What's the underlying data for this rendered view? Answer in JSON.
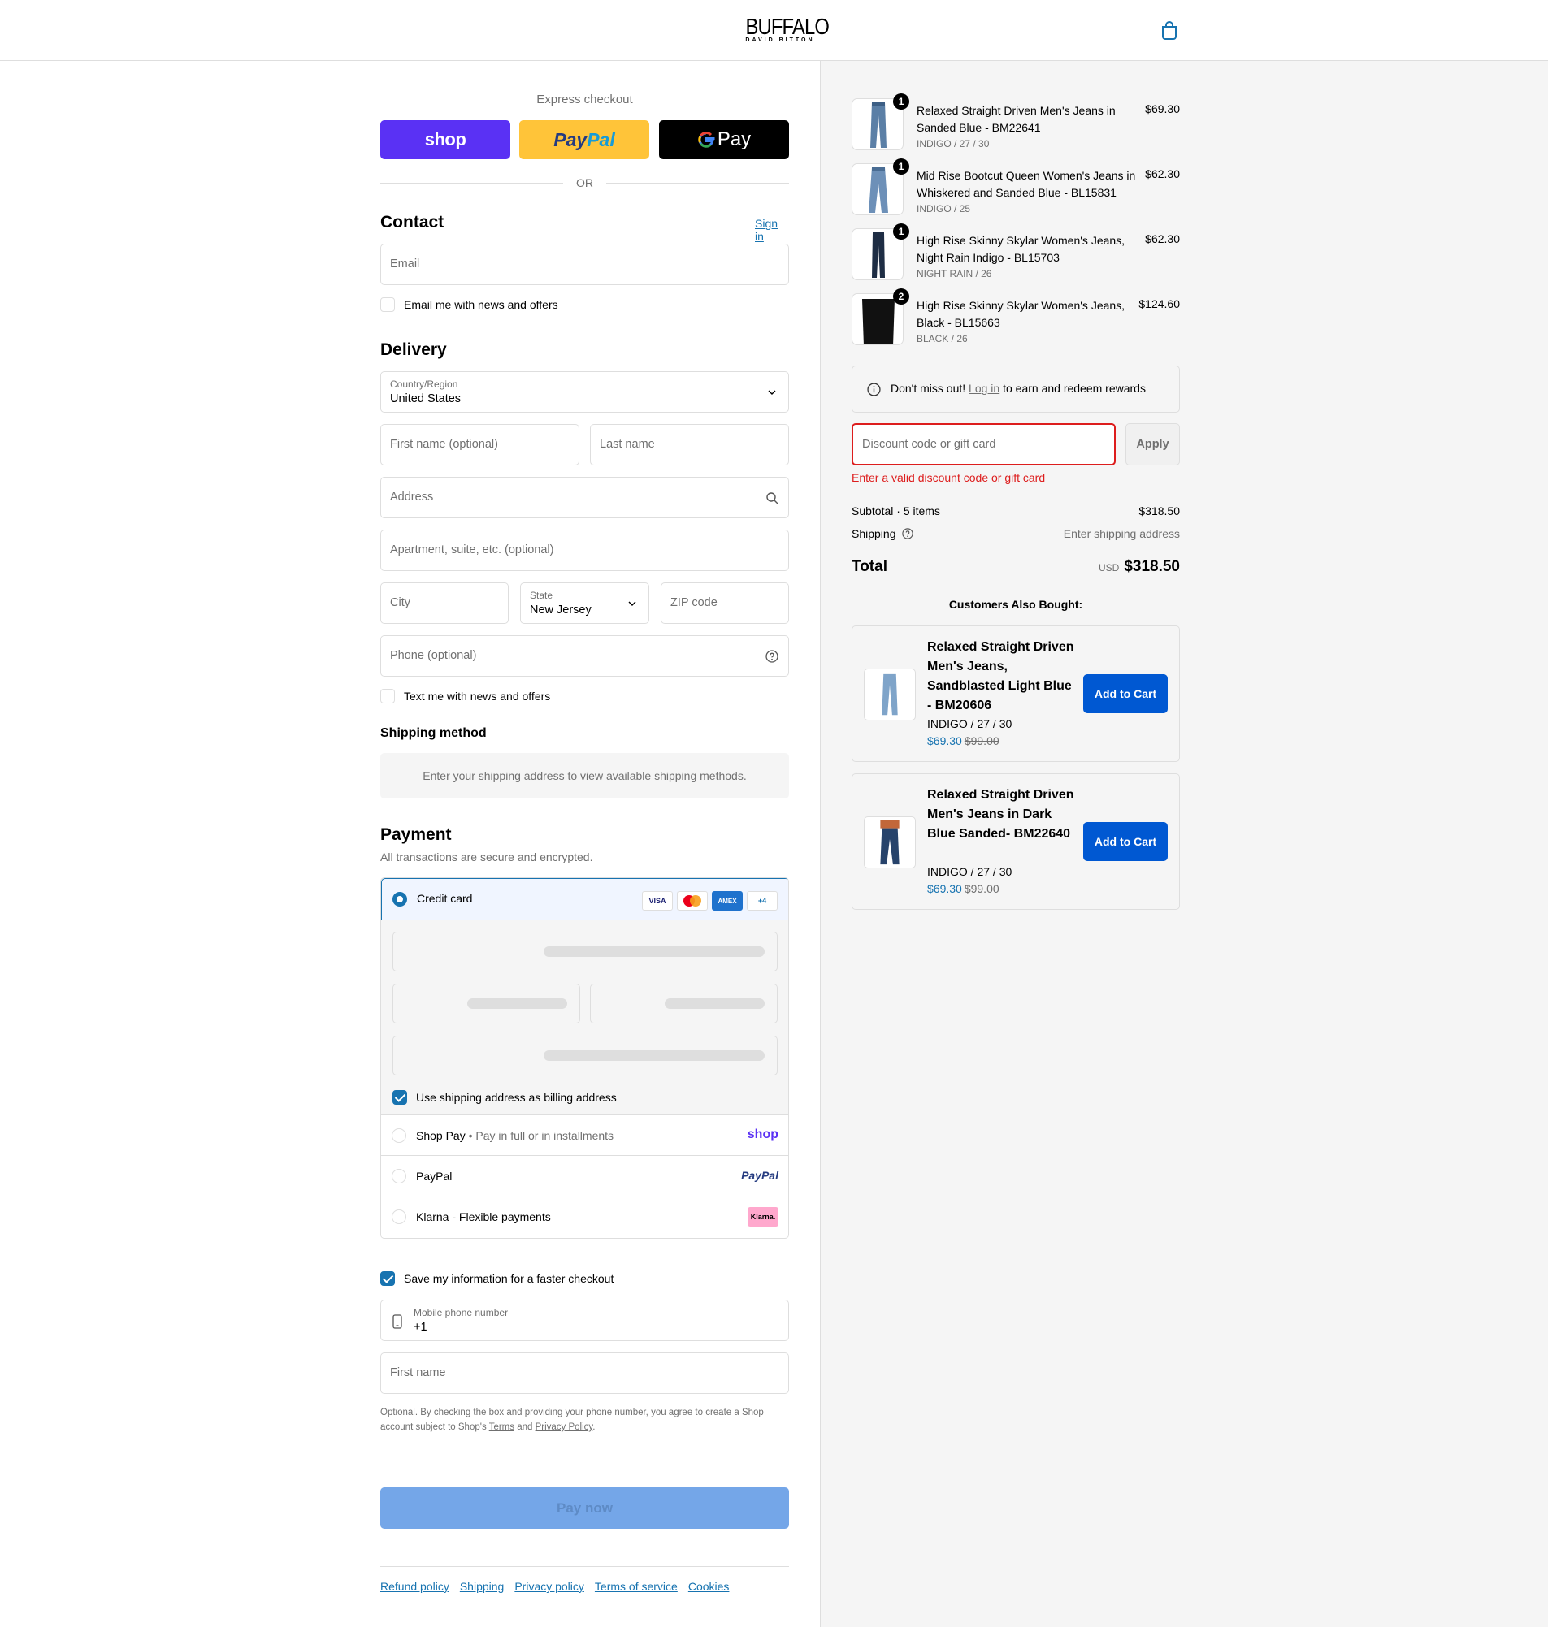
{
  "brand": {
    "name": "BUFFALO",
    "tagline": "DAVID BITTON"
  },
  "express": {
    "title": "Express checkout",
    "shop_label": "shop",
    "paypal_label_a": "Pay",
    "paypal_label_b": "Pal",
    "gpay_label": "Pay",
    "or_text": "OR"
  },
  "contact": {
    "heading": "Contact",
    "sign_in": "Sign in",
    "email_placeholder": "Email",
    "newsletter_label": "Email me with news and offers"
  },
  "delivery": {
    "heading": "Delivery",
    "country_label": "Country/Region",
    "country_value": "United States",
    "first_name_placeholder": "First name (optional)",
    "last_name_placeholder": "Last name",
    "address_placeholder": "Address",
    "apartment_placeholder": "Apartment, suite, etc. (optional)",
    "city_placeholder": "City",
    "state_label": "State",
    "state_value": "New Jersey",
    "zip_placeholder": "ZIP code",
    "phone_placeholder": "Phone (optional)",
    "sms_label": "Text me with news and offers"
  },
  "shipping_method": {
    "heading": "Shipping method",
    "message": "Enter your shipping address to view available shipping methods."
  },
  "payment": {
    "heading": "Payment",
    "subtitle": "All transactions are secure and encrypted.",
    "credit_card_label": "Credit card",
    "card_logos": [
      "VISA",
      "",
      "AMEX",
      "+4"
    ],
    "billing_same_label": "Use shipping address as billing address",
    "shop_pay_label": "Shop Pay",
    "shop_pay_sub": "Pay in full or in installments",
    "shop_pay_logo": "shop",
    "paypal_label": "PayPal",
    "paypal_logo": "PayPal",
    "klarna_label": "Klarna - Flexible payments",
    "klarna_logo": "Klarna."
  },
  "save_info": {
    "label": "Save my information for a faster checkout",
    "mobile_label": "Mobile phone number",
    "mobile_value": "+1",
    "first_name_placeholder": "First name",
    "legal_text_1": "Optional. By checking the box and providing your phone number, you agree to create a Shop account subject to Shop's ",
    "terms": "Terms",
    "legal_and": " and ",
    "privacy": "Privacy Policy",
    "legal_end": "."
  },
  "pay_now": "Pay now",
  "footer_links": [
    "Refund policy",
    "Shipping",
    "Privacy policy",
    "Terms of service",
    "Cookies"
  ],
  "cart": {
    "items": [
      {
        "qty": "1",
        "name": "Relaxed Straight Driven Men's Jeans in Sanded Blue - BM22641",
        "variant": "INDIGO / 27 / 30",
        "price": "$69.30"
      },
      {
        "qty": "1",
        "name": "Mid Rise Bootcut Queen Women's Jeans in Whiskered and Sanded Blue - BL15831",
        "variant": "INDIGO / 25",
        "price": "$62.30"
      },
      {
        "qty": "1",
        "name": "High Rise Skinny Skylar Women's Jeans, Night Rain Indigo - BL15703",
        "variant": "NIGHT RAIN / 26",
        "price": "$62.30"
      },
      {
        "qty": "2",
        "name": "High Rise Skinny Skylar Women's Jeans, Black - BL15663",
        "variant": "BLACK / 26",
        "price": "$124.60"
      }
    ],
    "rewards_pre": "Don't miss out! ",
    "rewards_link": "Log in",
    "rewards_post": " to earn and redeem rewards",
    "discount_placeholder": "Discount code or gift card",
    "apply_label": "Apply",
    "discount_error": "Enter a valid discount code or gift card",
    "subtotal_label": "Subtotal · 5 items",
    "subtotal_value": "$318.50",
    "shipping_label": "Shipping",
    "shipping_value": "Enter shipping address",
    "total_label": "Total",
    "total_currency": "USD",
    "total_value": "$318.50"
  },
  "recommendations": {
    "heading": "Customers Also Bought:",
    "items": [
      {
        "name": "Relaxed Straight Driven Men's Jeans, Sandblasted Light Blue - BM20606",
        "variant": "INDIGO / 27 / 30",
        "sale_price": "$69.30",
        "orig_price": "$99.00",
        "button": "Add to Cart"
      },
      {
        "name": "Relaxed Straight Driven Men's Jeans in Dark Blue Sanded- BM22640",
        "variant": "INDIGO / 27 / 30",
        "sale_price": "$69.30",
        "orig_price": "$99.00",
        "button": "Add to Cart"
      }
    ]
  },
  "colors": {
    "accent": "#1773b0",
    "error": "#dd1d1d",
    "shop_purple": "#5a31f4",
    "paypal_yellow": "#ffc439",
    "add_to_cart": "#0058d2"
  }
}
